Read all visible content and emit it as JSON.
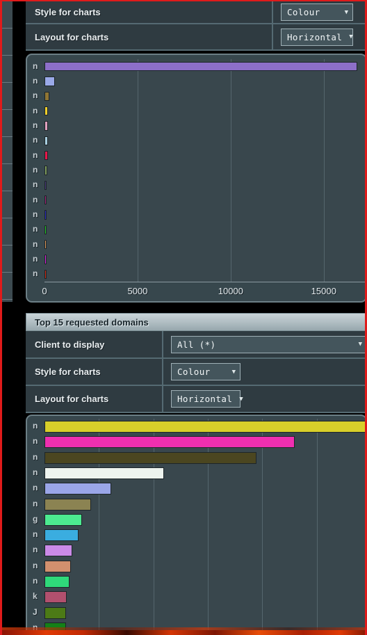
{
  "top_panel": {
    "rows": [
      {
        "label": "Style for charts",
        "control": "Colour",
        "arrow": "▼"
      },
      {
        "label": "Layout for charts",
        "control": "Horizontal",
        "arrow": "▼"
      }
    ]
  },
  "section": {
    "title": "Top 15 requested domains",
    "rows": [
      {
        "label": "Client to display",
        "control": "All (*)",
        "arrow": "▼"
      },
      {
        "label": "Style for charts",
        "control": "Colour",
        "arrow": "▼"
      },
      {
        "label": "Layout for charts",
        "control": "Horizontal",
        "arrow": "▼"
      }
    ]
  },
  "chart_data": [
    {
      "id": "chart-top-clients",
      "type": "bar",
      "orientation": "horizontal",
      "title": "",
      "xlabel": "",
      "ylabel": "",
      "xlim": [
        0,
        17250
      ],
      "xticks": [
        0,
        5000,
        10000,
        15000
      ],
      "xtick_labels": [
        "0",
        "5000",
        "10000",
        "15000"
      ],
      "grid": true,
      "categories": [
        "n",
        "n",
        "n",
        "n",
        "n",
        "n",
        "n",
        "n",
        "n",
        "n",
        "n",
        "n",
        "n",
        "n",
        "n"
      ],
      "values": [
        16800,
        570,
        250,
        200,
        190,
        185,
        180,
        150,
        95,
        90,
        85,
        80,
        75,
        70,
        65
      ],
      "colors": [
        "#8d6fc9",
        "#9aa9e8",
        "#8f7534",
        "#f0cf2a",
        "#e0a0be",
        "#a8cfe0",
        "#e8174a",
        "#7d9a5b",
        "#4a3a7a",
        "#a6227a",
        "#2b2bc4",
        "#22cc22",
        "#e09a5a",
        "#e020e0",
        "#d42a12"
      ]
    },
    {
      "id": "chart-top-domains",
      "type": "bar",
      "orientation": "horizontal",
      "title": "Top 15 requested domains",
      "xlabel": "",
      "ylabel": "",
      "xlim": [
        0,
        5900
      ],
      "grid": true,
      "gridlines": [
        1000,
        2000,
        3000,
        4000,
        5000
      ],
      "categories": [
        "n",
        "n",
        "n",
        "n",
        "n",
        "n",
        "g",
        "n",
        "n",
        "n",
        "n",
        "k",
        "J",
        "n"
      ],
      "values": [
        5900,
        4600,
        3900,
        2200,
        1230,
        850,
        690,
        620,
        510,
        480,
        465,
        410,
        400,
        390
      ],
      "colors": [
        "#d8cf2a",
        "#ef2fb0",
        "#4b4620",
        "#edf3ee",
        "#9aa6e8",
        "#8b8352",
        "#4ceb90",
        "#3aade0",
        "#cb8ae8",
        "#d2906e",
        "#2fd97a",
        "#b2506e",
        "#4c7a16",
        "#148018"
      ]
    }
  ]
}
